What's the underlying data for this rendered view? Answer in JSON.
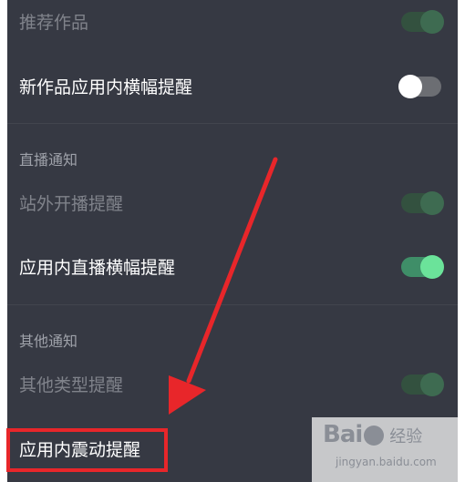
{
  "settings": {
    "rows": [
      {
        "label": "推荐作品",
        "toggle": "on",
        "dim": true
      },
      {
        "label": "新作品应用内横幅提醒",
        "toggle": "off",
        "dim": false
      },
      {
        "label": "站外开播提醒",
        "toggle": "on",
        "dim": true
      },
      {
        "label": "应用内直播横幅提醒",
        "toggle": "on",
        "dim": false
      },
      {
        "label": "其他类型提醒",
        "toggle": "on",
        "dim": true
      },
      {
        "label": "应用内震动提醒",
        "dim": false
      }
    ],
    "sections": {
      "live": "直播通知",
      "other": "其他通知"
    }
  },
  "watermark": {
    "brand_pre": "Bai",
    "brand_post": "经验",
    "url": "jingyan.baidu.com"
  },
  "colors": {
    "background": "#363943",
    "toggle_on": "#6be39a",
    "highlight": "#e8262a"
  }
}
